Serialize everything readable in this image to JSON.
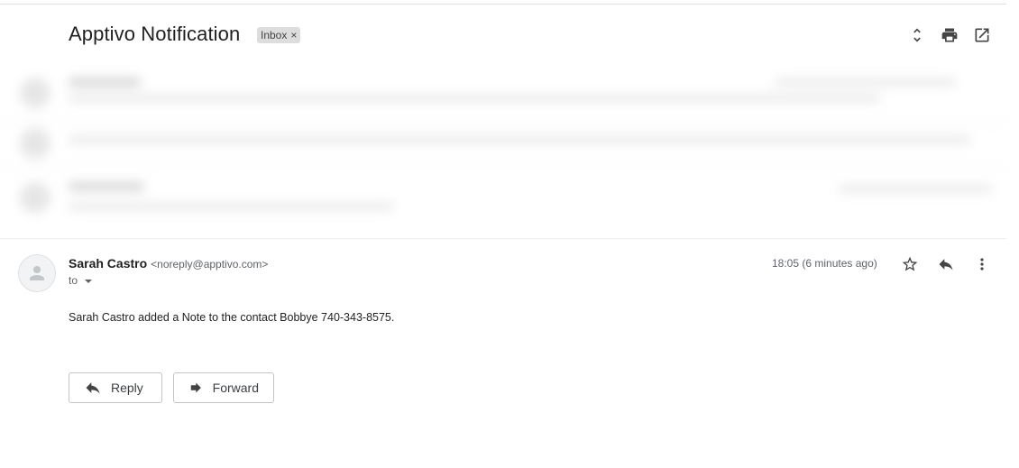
{
  "header": {
    "subject": "Apptivo Notification",
    "label": "Inbox",
    "label_remove": "×",
    "icons": [
      "expand-collapse-icon",
      "print-icon",
      "open-in-new-window-icon"
    ]
  },
  "message": {
    "sender_name": "Sarah Castro",
    "sender_email": "<noreply@apptivo.com>",
    "recipient_label": "to",
    "timestamp": "18:05 (6 minutes ago)",
    "body": "Sarah Castro added a Note to the contact Bobbye 740-343-8575.",
    "icons": [
      "star-icon",
      "reply-icon",
      "more-vert-icon"
    ]
  },
  "actions": {
    "reply_label": "Reply",
    "forward_label": "Forward"
  },
  "colors": {
    "label_bg": "#dddddd",
    "text_primary": "#1f1f1f",
    "text_secondary": "#5f6368"
  }
}
